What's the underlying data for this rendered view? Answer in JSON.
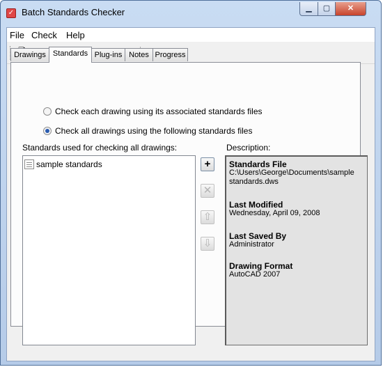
{
  "window": {
    "title": "Batch Standards Checker"
  },
  "menu": [
    "File",
    "Check",
    "Help"
  ],
  "toolbar": {
    "new_icon": "new-file-icon",
    "open_icon": "open-folder-icon",
    "save_icon": "save-icon",
    "saveas_icon": "save-as-icon",
    "check_icon": "check-icon",
    "remove_icon": "delete-icon",
    "report_icon": "report-icon",
    "export_icon": "export-icon",
    "help_icon": "help-icon",
    "help_glyph": "?"
  },
  "tabs": [
    "Drawings",
    "Standards",
    "Plug-ins",
    "Notes",
    "Progress"
  ],
  "active_tab": "Standards",
  "options": {
    "option1": "Check each drawing using its associated standards files",
    "option2": "Check all drawings using the following standards files",
    "selected": 2
  },
  "list": {
    "label": "Standards used for checking all drawings:",
    "items": [
      "sample standards"
    ]
  },
  "buttons": {
    "add": "+",
    "remove": "✕",
    "up": "⇧",
    "down": "⇩"
  },
  "description": {
    "label": "Description:",
    "sections": [
      {
        "title": "Standards File",
        "value": "C:\\Users\\George\\Documents\\sample standards.dws"
      },
      {
        "title": "Last Modified",
        "value": "Wednesday, April 09, 2008"
      },
      {
        "title": "Last Saved By",
        "value": "Administrator"
      },
      {
        "title": "Drawing Format",
        "value": "AutoCAD 2007"
      }
    ]
  },
  "colors": {
    "titlebar": "#c9dcf3",
    "close_button": "#c8432b",
    "radio_selected": "#2a5bb0"
  }
}
